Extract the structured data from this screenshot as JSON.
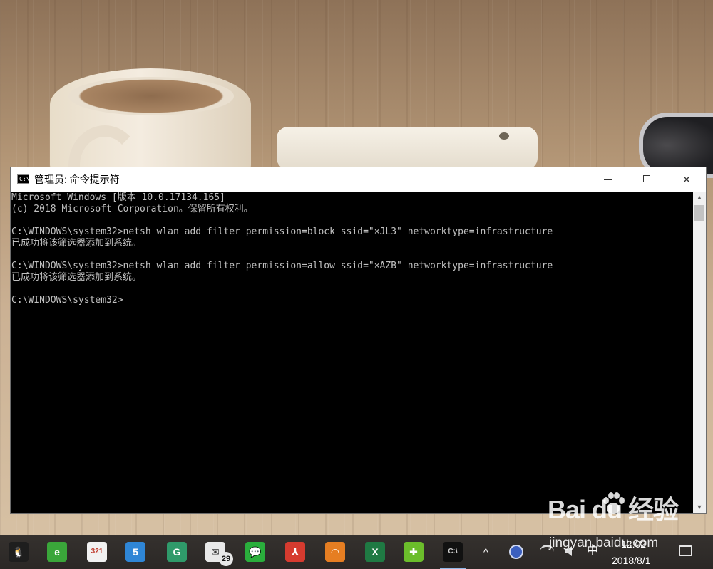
{
  "window": {
    "title": "管理员: 命令提示符",
    "icon_label": "C:\\_"
  },
  "console_lines": [
    "Microsoft Windows [版本 10.0.17134.165]",
    "(c) 2018 Microsoft Corporation。保留所有权利。",
    "",
    "C:\\WINDOWS\\system32>netsh wlan add filter permission=block ssid=\"×JL3\" networktype=infrastructure",
    "已成功将该筛选器添加到系统。",
    "",
    "C:\\WINDOWS\\system32>netsh wlan add filter permission=allow ssid=\"×AZB\" networktype=infrastructure",
    "已成功将该筛选器添加到系统。",
    "",
    "C:\\WINDOWS\\system32>"
  ],
  "window_buttons": {
    "close_glyph": "✕"
  },
  "scrollbar": {
    "up_glyph": "▲",
    "down_glyph": "▼"
  },
  "taskbar": {
    "apps": [
      {
        "name": "QQ",
        "glyph": "🐧",
        "color": "#1e1e1e",
        "fg": "#ffffff"
      },
      {
        "name": "IE Browser",
        "glyph": "e",
        "color": "#3aa63a",
        "fg": "#ffffff"
      },
      {
        "name": "Calendar",
        "glyph": "321",
        "color": "#f2f2f2",
        "fg": "#c0392b"
      },
      {
        "name": "Game",
        "glyph": "5",
        "color": "#2f86d6",
        "fg": "#ffffff"
      },
      {
        "name": "Guard",
        "glyph": "G",
        "color": "#2f9a6a",
        "fg": "#ffffff"
      },
      {
        "name": "Mail",
        "glyph": "✉",
        "color": "#e9e9e9",
        "fg": "#333333"
      },
      {
        "name": "WeChat",
        "glyph": "💬",
        "color": "#2aae3c",
        "fg": "#ffffff"
      },
      {
        "name": "Reader",
        "glyph": "⅄",
        "color": "#d63b2f",
        "fg": "#ffffff"
      },
      {
        "name": "VPN",
        "glyph": "◠",
        "color": "#e67e22",
        "fg": "#ffffff"
      },
      {
        "name": "Excel",
        "glyph": "X",
        "color": "#1f7a43",
        "fg": "#ffffff"
      },
      {
        "name": "Security",
        "glyph": "✚",
        "color": "#6bbd2b",
        "fg": "#ffffff"
      },
      {
        "name": "Command Prompt",
        "glyph": "C:\\",
        "color": "#111111",
        "fg": "#cfcfcf"
      }
    ],
    "mail_badge": "29",
    "tray": {
      "chevron": "^",
      "ime": "中",
      "time": "12:02",
      "date": "2018/8/1"
    }
  },
  "watermark": {
    "logo_text": "Bai  du 经验",
    "url": "jingyan.baidu.com"
  }
}
